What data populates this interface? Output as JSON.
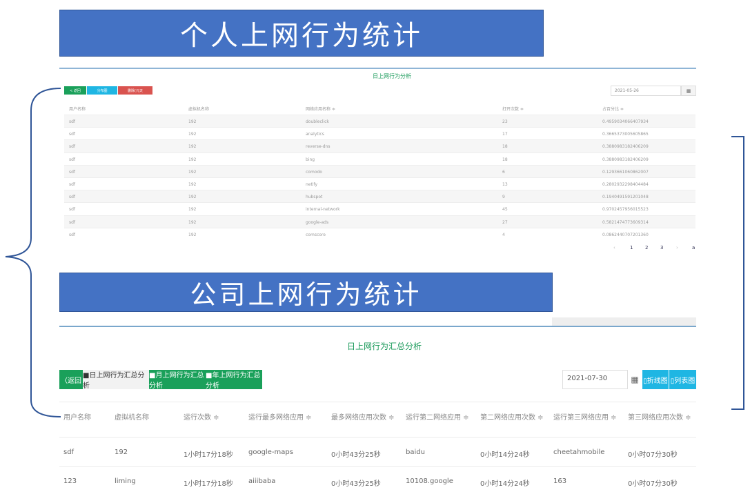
{
  "banners": {
    "personal": "个人上网行为统计",
    "company": "公司上网行为统计"
  },
  "panel1": {
    "title": "日上网行为分析",
    "buttons": [
      "< 返回",
      "分布图",
      "删除(元天"
    ],
    "date": "2021-05-26",
    "columns": [
      "用户名称",
      "虚拟机名称",
      "网络应用名称 ≑",
      "打开次数 ≑",
      "占百分比 ≑"
    ],
    "rows": [
      [
        "sdf",
        "192",
        "doubleclick",
        "23",
        "0.4959034066407934"
      ],
      [
        "sdf",
        "192",
        "analytics",
        "17",
        "0.3665373005605865"
      ],
      [
        "sdf",
        "192",
        "reverse-dns",
        "18",
        "0.3880983182406209"
      ],
      [
        "sdf",
        "192",
        "bing",
        "18",
        "0.3880983182406209"
      ],
      [
        "sdf",
        "192",
        "comodo",
        "6",
        "0.1293661060862007"
      ],
      [
        "sdf",
        "192",
        "netify",
        "13",
        "0.2802932298404484"
      ],
      [
        "sdf",
        "192",
        "hubspot",
        "9",
        "0.1940491591201048"
      ],
      [
        "sdf",
        "192",
        "internal-network",
        "45",
        "0.9702457956015523"
      ],
      [
        "sdf",
        "192",
        "google-ads",
        "27",
        "0.5821474773609314"
      ],
      [
        "sdf",
        "192",
        "comscore",
        "4",
        "0.0862440707201360"
      ]
    ],
    "pager": [
      "‹",
      "1",
      "2",
      "3",
      "›",
      "a"
    ]
  },
  "panel2": {
    "title": "日上网行为汇总分析",
    "back_label": "〈返回",
    "tabs": [
      "■日上网行为汇总分析",
      "■月上网行为汇总分析",
      "■年上网行为汇总分析"
    ],
    "date": "2021-07-30",
    "calendar_icon": "▦",
    "buttons": [
      "▯折线图",
      "▯列表图"
    ],
    "columns": [
      "用户名称",
      "虚拟机名称",
      "运行次数 ≑",
      "运行最多网络应用 ≑",
      "最多网络应用次数 ≑",
      "运行第二网络应用 ≑",
      "第二网络应用次数 ≑",
      "运行第三网络应用 ≑",
      "第三网络应用次数 ≑"
    ],
    "rows": [
      [
        "sdf",
        "192",
        "1小时17分18秒",
        "google-maps",
        "0小时43分25秒",
        "baidu",
        "0小时14分24秒",
        "cheetahmobile",
        "0小时07分30秒"
      ],
      [
        "123",
        "liming",
        "1小时17分18秒",
        "aiiibaba",
        "0小时43分25秒",
        "10108.google",
        "0小时14分24秒",
        "163",
        "0小时07分30秒"
      ]
    ]
  }
}
